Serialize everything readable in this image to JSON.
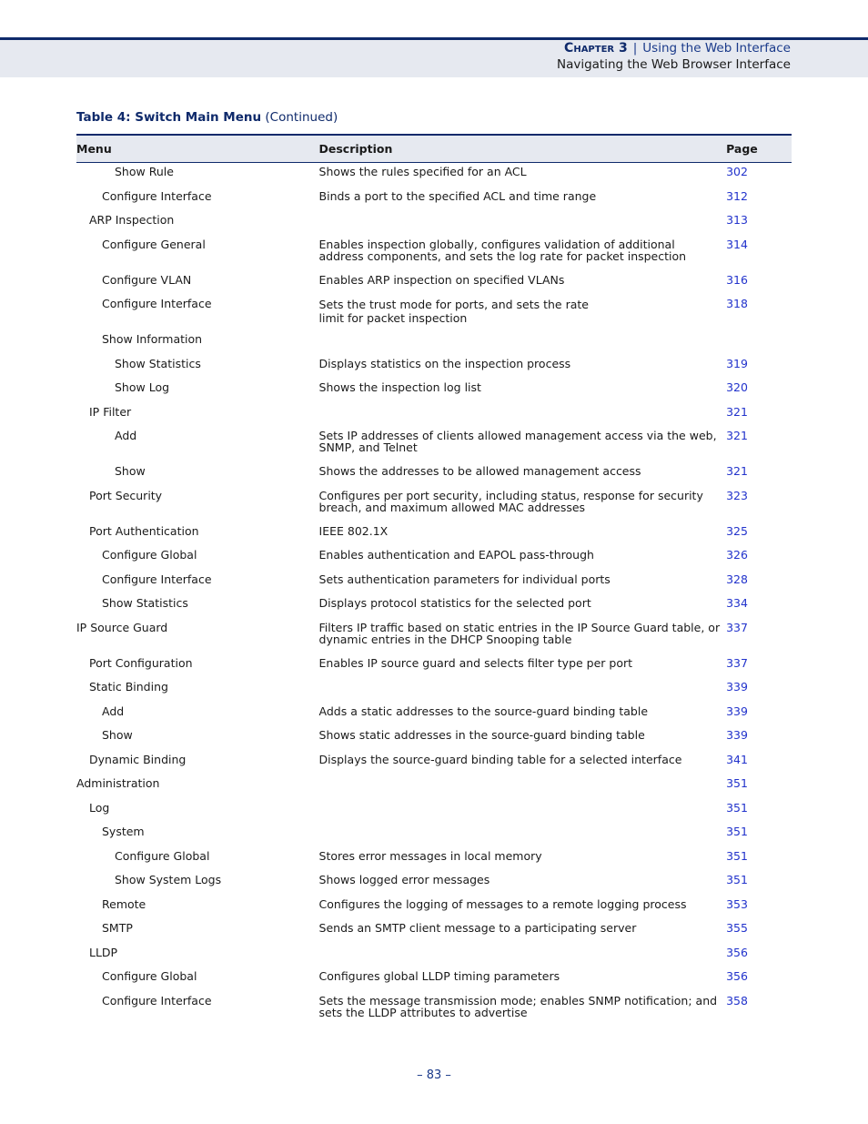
{
  "header": {
    "chapter": "Chapter 3",
    "separator": "|",
    "chapter_title": "Using the Web Interface",
    "section_title": "Navigating the Web Browser Interface"
  },
  "caption": {
    "label": "Table 4: Switch Main Menu",
    "suffix": "(Continued)"
  },
  "table": {
    "columns": [
      "Menu",
      "Description",
      "Page"
    ],
    "rows": [
      {
        "menu": "Show Rule",
        "level": 3,
        "desc": "Shows the rules specified for an ACL",
        "page": "302"
      },
      {
        "menu": "Configure Interface",
        "level": 2,
        "desc": "Binds a port to the specified ACL and time range",
        "page": "312"
      },
      {
        "menu": "ARP Inspection",
        "level": 1,
        "desc": "",
        "page": "313"
      },
      {
        "menu": "Configure General",
        "level": 2,
        "desc": "Enables inspection globally, configures validation of additional address components, and sets the log rate for packet inspection",
        "page": "314"
      },
      {
        "menu": "Configure VLAN",
        "level": 2,
        "desc": "Enables ARP inspection on specified VLANs",
        "page": "316"
      },
      {
        "menu": "Configure Interface",
        "level": 2,
        "desc": "Sets the trust mode for ports, and sets the rate limit for packet inspection",
        "page": "318"
      },
      {
        "menu": "Show Information",
        "level": 2,
        "desc": "",
        "page": ""
      },
      {
        "menu": "Show Statistics",
        "level": 3,
        "desc": "Displays statistics on the inspection process",
        "page": "319"
      },
      {
        "menu": "Show Log",
        "level": 3,
        "desc": "Shows the inspection log list",
        "page": "320"
      },
      {
        "menu": "IP Filter",
        "level": 1,
        "desc": "",
        "page": "321"
      },
      {
        "menu": "Add",
        "level": 3,
        "desc": "Sets IP addresses of clients allowed management access via the web, SNMP, and Telnet",
        "page": "321"
      },
      {
        "menu": "Show",
        "level": 3,
        "desc": "Shows the addresses to be allowed management access",
        "page": "321"
      },
      {
        "menu": "Port Security",
        "level": 1,
        "desc": "Configures per port security, including status, response for security breach, and maximum allowed MAC addresses",
        "page": "323"
      },
      {
        "menu": "Port Authentication",
        "level": 1,
        "desc": "IEEE 802.1X",
        "page": "325"
      },
      {
        "menu": "Configure Global",
        "level": 2,
        "desc": "Enables authentication and EAPOL pass-through",
        "page": "326"
      },
      {
        "menu": "Configure Interface",
        "level": 2,
        "desc": "Sets authentication parameters for individual ports",
        "page": "328"
      },
      {
        "menu": "Show Statistics",
        "level": 2,
        "desc": "Displays protocol statistics for the selected port",
        "page": "334"
      },
      {
        "menu": "IP Source Guard",
        "level": 0,
        "desc": "Filters IP traffic based on static entries in the IP Source Guard table, or dynamic entries in the DHCP Snooping table",
        "page": "337"
      },
      {
        "menu": "Port Configuration",
        "level": 1,
        "desc": "Enables IP source guard and selects filter type per port",
        "page": "337"
      },
      {
        "menu": "Static Binding",
        "level": 1,
        "desc": "",
        "page": "339"
      },
      {
        "menu": "Add",
        "level": 2,
        "desc": "Adds a static addresses to the source-guard binding table",
        "page": "339"
      },
      {
        "menu": "Show",
        "level": 2,
        "desc": "Shows static addresses in the source-guard binding table",
        "page": "339"
      },
      {
        "menu": "Dynamic Binding",
        "level": 1,
        "desc": "Displays the source-guard binding table for a selected interface",
        "page": "341"
      },
      {
        "menu": "Administration",
        "level": 0,
        "desc": "",
        "page": "351"
      },
      {
        "menu": "Log",
        "level": 1,
        "desc": "",
        "page": "351"
      },
      {
        "menu": "System",
        "level": 2,
        "desc": "",
        "page": "351"
      },
      {
        "menu": "Configure Global",
        "level": 3,
        "desc": "Stores error messages in local memory",
        "page": "351"
      },
      {
        "menu": "Show System Logs",
        "level": 3,
        "desc": "Shows logged error messages",
        "page": "351"
      },
      {
        "menu": "Remote",
        "level": 2,
        "desc": "Configures the logging of messages to a remote logging process",
        "page": "353"
      },
      {
        "menu": "SMTP",
        "level": 2,
        "desc": "Sends an SMTP client message to a participating server",
        "page": "355"
      },
      {
        "menu": "LLDP",
        "level": 1,
        "desc": "",
        "page": "356"
      },
      {
        "menu": "Configure Global",
        "level": 2,
        "desc": "Configures global LLDP timing parameters",
        "page": "356"
      },
      {
        "menu": "Configure Interface",
        "level": 2,
        "desc": "Sets the message transmission mode; enables SNMP notification; and sets the LLDP attributes to advertise",
        "page": "358"
      }
    ]
  },
  "footer": {
    "page_number": "–  83  –"
  },
  "colors": {
    "accent_navy": "#0f2a6b",
    "link_blue": "#2233cc",
    "band_bg": "#e6e9f0"
  }
}
